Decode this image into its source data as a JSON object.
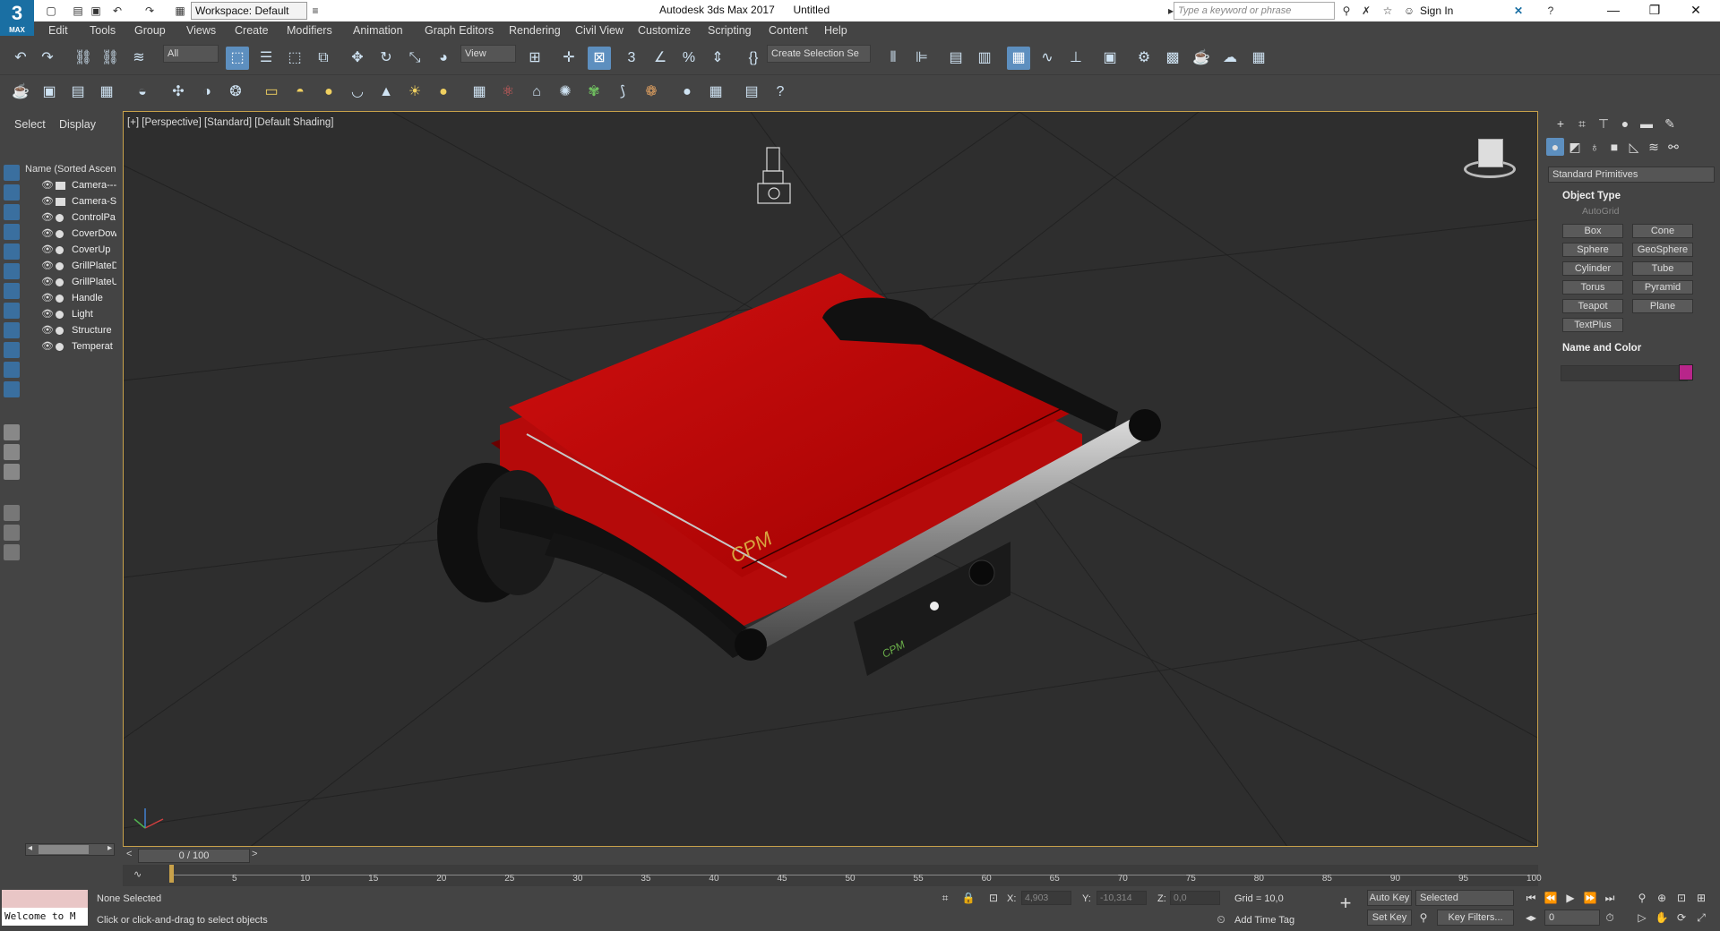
{
  "app": {
    "logo_text": "3",
    "logo_sub": "MAX",
    "title": "Autodesk 3ds Max 2017",
    "document": "Untitled",
    "workspace": "Workspace: Default",
    "search_placeholder": "Type a keyword or phrase",
    "sign_in": "Sign In"
  },
  "menu": [
    "Edit",
    "Tools",
    "Group",
    "Views",
    "Create",
    "Modifiers",
    "Animation",
    "Graph Editors",
    "Rendering",
    "Civil View",
    "Customize",
    "Scripting",
    "Content",
    "Help"
  ],
  "toolbar": {
    "filter": "All",
    "reference_coord": "View",
    "selection_set": "Create Selection Se"
  },
  "scene_explorer": {
    "tabs": [
      "Select",
      "Display"
    ],
    "header": "Name (Sorted Ascending)",
    "items": [
      {
        "name": "Camera---A",
        "kind": "camera"
      },
      {
        "name": "Camera-Si",
        "kind": "camera"
      },
      {
        "name": "ControlPa",
        "kind": "object"
      },
      {
        "name": "CoverDow",
        "kind": "object"
      },
      {
        "name": "CoverUp",
        "kind": "object"
      },
      {
        "name": "GrillPlateD",
        "kind": "object"
      },
      {
        "name": "GrillPlateU",
        "kind": "object"
      },
      {
        "name": "Handle",
        "kind": "object"
      },
      {
        "name": "Light",
        "kind": "object"
      },
      {
        "name": "Structure",
        "kind": "object"
      },
      {
        "name": "Temperat",
        "kind": "object"
      }
    ]
  },
  "viewport": {
    "label": "[+] [Perspective] [Standard] [Default Shading]",
    "logo_text": "CPM"
  },
  "command_panel": {
    "category": "Standard Primitives",
    "object_type_title": "Object Type",
    "autogrid": "AutoGrid",
    "primitives": [
      "Box",
      "Cone",
      "Sphere",
      "GeoSphere",
      "Cylinder",
      "Tube",
      "Torus",
      "Pyramid",
      "Teapot",
      "Plane",
      "TextPlus"
    ],
    "name_color_title": "Name and Color",
    "object_color": "#b8258a"
  },
  "timeline": {
    "slider": "0 / 100",
    "ticks": [
      "5",
      "10",
      "15",
      "20",
      "25",
      "30",
      "35",
      "40",
      "45",
      "50",
      "55",
      "60",
      "65",
      "70",
      "75",
      "80",
      "85",
      "90",
      "95",
      "100"
    ]
  },
  "status": {
    "maxscript": "Welcome to M",
    "selection": "None Selected",
    "prompt": "Click or click-and-drag to select objects",
    "x_label": "X:",
    "x_value": "4,903",
    "y_label": "Y:",
    "y_value": "-10,314",
    "z_label": "Z:",
    "z_value": "0,0",
    "grid": "Grid = 10,0",
    "add_time_tag": "Add Time Tag",
    "auto_key": "Auto Key",
    "set_key": "Set Key",
    "key_mode": "Selected",
    "key_filters": "Key Filters...",
    "frame": "0"
  }
}
